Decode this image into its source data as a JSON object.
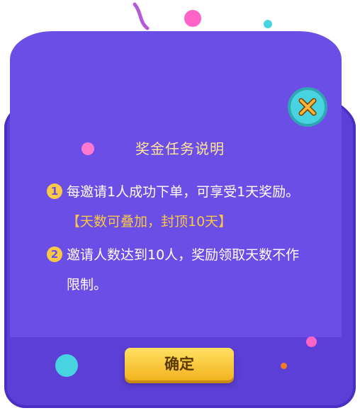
{
  "dialog": {
    "title": "奖金任务说明",
    "items": [
      {
        "number": "1",
        "text": "每邀请1人成功下单，可享受1天奖励。",
        "note": "【天数可叠加，封顶10天】"
      },
      {
        "number": "2",
        "text": "邀请人数达到10人，奖励领取天数不作",
        "text_cont": "限制。"
      }
    ],
    "confirm_label": "确定"
  },
  "colors": {
    "modal": "#5b3fd6",
    "panel": "#6b4ee6",
    "title": "#ffe79a",
    "accent": "#f7c946",
    "button": "#f3b320",
    "close": "#48d3e0"
  },
  "icons": [
    "close-icon"
  ]
}
